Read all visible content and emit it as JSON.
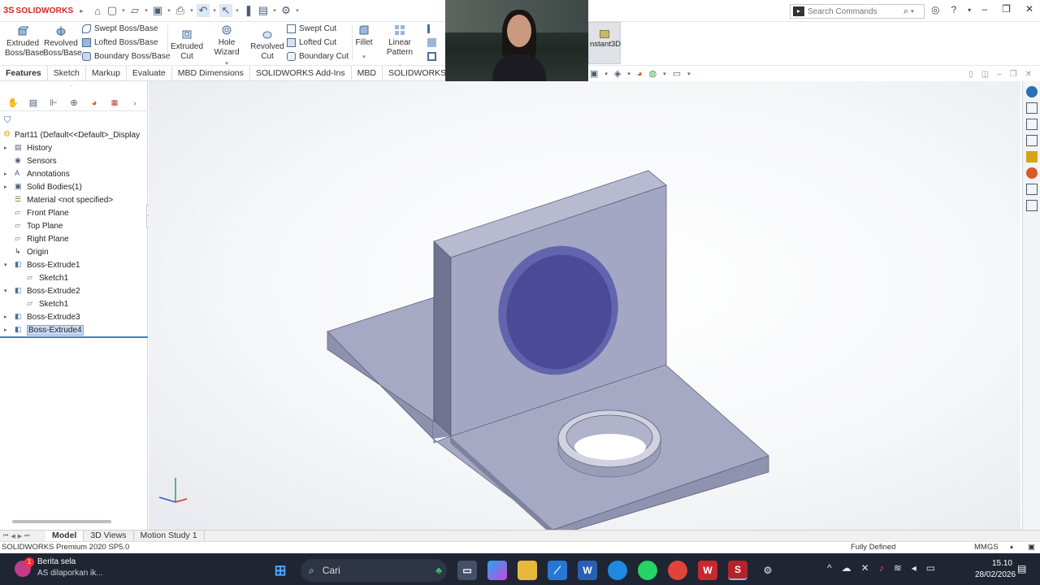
{
  "app": {
    "brand_prefix": "3S",
    "brand_name": "SOLIDWORKS",
    "search_placeholder": "Search Commands"
  },
  "ribbon": {
    "extruded_boss": "Extruded\nBoss/Base",
    "revolved_boss": "Revolved\nBoss/Base",
    "swept_boss": "Swept Boss/Base",
    "lofted_boss": "Lofted Boss/Base",
    "boundary_boss": "Boundary Boss/Base",
    "extruded_cut": "Extruded\nCut",
    "hole_wizard": "Hole Wizard",
    "revolved_cut": "Revolved\nCut",
    "swept_cut": "Swept Cut",
    "lofted_cut": "Lofted Cut",
    "boundary_cut": "Boundary Cut",
    "fillet": "Fillet",
    "linear_pattern": "Linear Pattern",
    "instant3d": "nstant3D"
  },
  "tabs": [
    "Features",
    "Sketch",
    "Markup",
    "Evaluate",
    "MBD Dimensions",
    "SOLIDWORKS Add-Ins",
    "MBD",
    "SOLIDWORKS Inspectio"
  ],
  "tree": {
    "root": "Part11  (Default<<Default>_Display",
    "items": [
      {
        "label": "History",
        "expand": "▸"
      },
      {
        "label": "Sensors",
        "expand": ""
      },
      {
        "label": "Annotations",
        "expand": "▸"
      },
      {
        "label": "Solid Bodies(1)",
        "expand": "▸"
      },
      {
        "label": "Material <not specified>",
        "expand": ""
      },
      {
        "label": "Front Plane",
        "expand": ""
      },
      {
        "label": "Top Plane",
        "expand": ""
      },
      {
        "label": "Right Plane",
        "expand": ""
      },
      {
        "label": "Origin",
        "expand": ""
      },
      {
        "label": "Boss-Extrude1",
        "expand": "▾"
      },
      {
        "label": "Sketch1",
        "expand": ""
      },
      {
        "label": "Boss-Extrude2",
        "expand": "▾"
      },
      {
        "label": "Sketch1",
        "expand": ""
      },
      {
        "label": "Boss-Extrude3",
        "expand": "▸"
      },
      {
        "label": "Boss-Extrude4",
        "expand": "▸"
      }
    ]
  },
  "bottom_tabs": [
    "Model",
    "3D Views",
    "Motion Study 1"
  ],
  "status": {
    "version": "SOLIDWORKS Premium 2020 SP5.0",
    "state": "Fully Defined",
    "units": "MMGS"
  },
  "taskbar": {
    "news_title": "Berita sela",
    "news_sub": "AS dilaporkan ik...",
    "news_badge": "1",
    "search": "Cari",
    "time": "15.10",
    "date": "28/02/2026"
  },
  "colors": {
    "part_face": "#a4a7c3",
    "part_top": "#b5b8d0",
    "part_dark": "#6f7290",
    "hole_fill": "#4a4a98",
    "accent_blue": "#3e7fc7",
    "brand_red": "#d4261f"
  }
}
